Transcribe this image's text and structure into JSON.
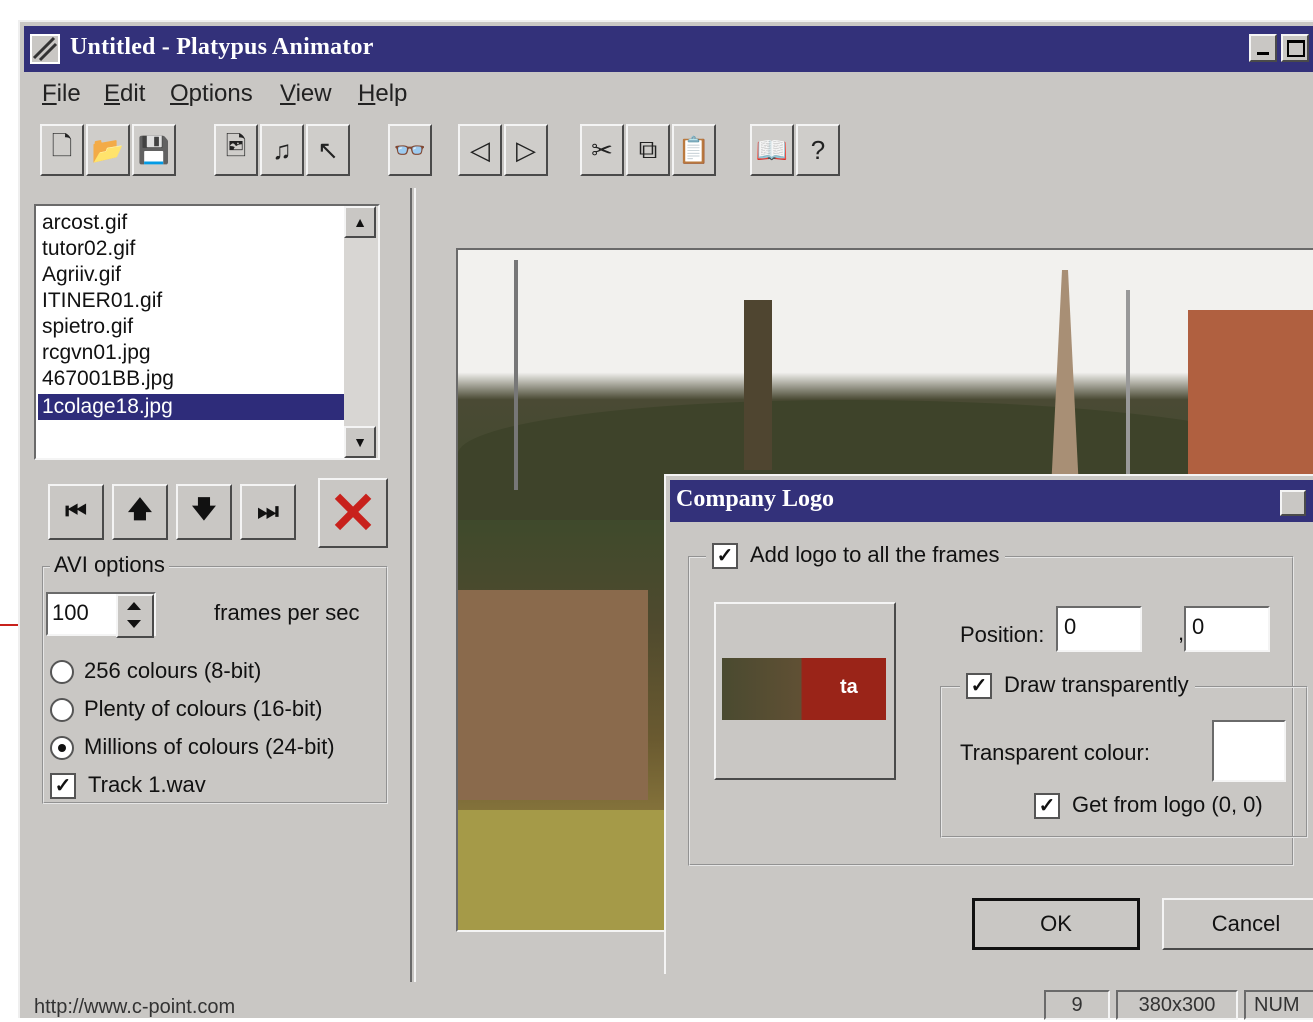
{
  "window": {
    "title": "Untitled - Platypus Animator"
  },
  "menu": [
    {
      "pre": "",
      "key": "F",
      "post": "ile"
    },
    {
      "pre": "",
      "key": "E",
      "post": "dit"
    },
    {
      "pre": "",
      "key": "O",
      "post": "ptions"
    },
    {
      "pre": "",
      "key": "V",
      "post": "iew"
    },
    {
      "pre": "",
      "key": "H",
      "post": "elp"
    }
  ],
  "files": [
    "arcost.gif",
    "tutor02.gif",
    "Agriiv.gif",
    "ITINER01.gif",
    "spietro.gif",
    "rcgvn01.jpg",
    "467001BB.jpg",
    "1colage18.jpg"
  ],
  "selected_file": "1colage18.jpg",
  "avi": {
    "legend": "AVI options",
    "fps_value": "100",
    "fps_label": "frames per sec",
    "color_options": [
      "256 colours (8-bit)",
      "Plenty of colours (16-bit)",
      "Millions of colours (24-bit)"
    ],
    "selected_color": "Millions of colours (24-bit)",
    "track_label": "Track  1.wav",
    "track_checked": true
  },
  "dialog": {
    "title": "Company Logo",
    "add_logo_label": "Add logo to all the frames",
    "logo_text": "ta",
    "position_label": "Position:",
    "position_x": "0",
    "position_y": "0",
    "position_sep": ",",
    "draw_transparent_label": "Draw transparently",
    "transparent_colour_label": "Transparent colour:",
    "transparent_colour": "#ffffff",
    "get_from_logo_label": "Get from logo (0, 0)",
    "ok_label": "OK",
    "cancel_label": "Cancel"
  },
  "status": {
    "url": "http://www.c-point.com",
    "frame": "9",
    "size": "380x300",
    "num": "NUM"
  },
  "colors": {
    "titlebar": "#33317a",
    "face": "#c9c7c4",
    "selection": "#2e2c7a",
    "delete": "#c8211c"
  }
}
